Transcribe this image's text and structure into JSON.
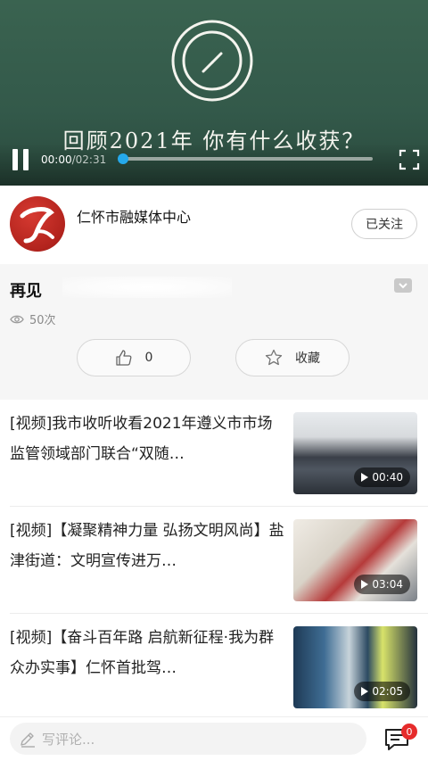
{
  "video": {
    "board_text": "回顾2021年  你有什么收获？",
    "current_time": "00:00",
    "duration": "/02:31",
    "progress": 0.0
  },
  "publisher": {
    "name": "仁怀市融媒体中心",
    "follow_label": "已关注"
  },
  "article": {
    "title": "再见",
    "views": "50次",
    "like_count": "0",
    "favorite_label": "收藏"
  },
  "news": [
    {
      "title": "[视频]我市收听收看2021年遵义市市场监管领域部门联合“双随…",
      "duration": "00:40"
    },
    {
      "title": "[视频]【凝聚精神力量 弘扬文明风尚】盐津街道：文明宣传进万…",
      "duration": "03:04"
    },
    {
      "title": "[视频]【奋斗百年路 启航新征程·我为群众办实事】仁怀首批驾…",
      "duration": "02:05"
    }
  ],
  "comment_bar": {
    "placeholder": "写评论...",
    "comment_count": "0"
  },
  "colors": {
    "accent": "#25a9ec",
    "badge": "#e62b2b",
    "chalkboard": "#34594a"
  }
}
